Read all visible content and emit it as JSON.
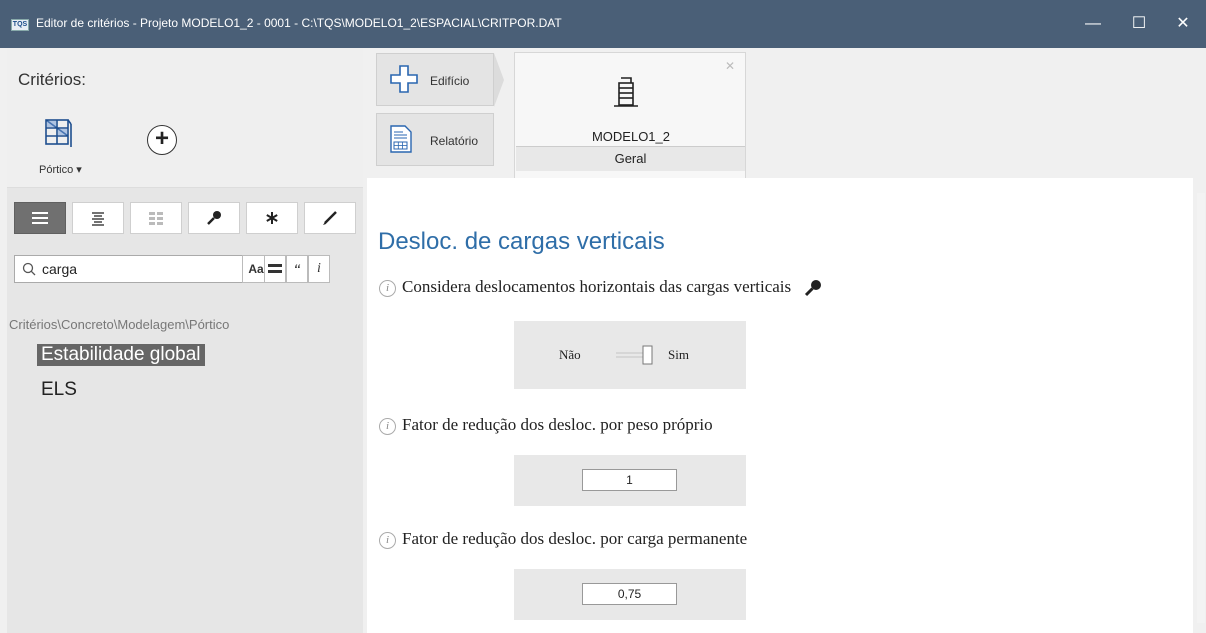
{
  "window": {
    "app_icon_text": "TQS",
    "title": "Editor de critérios - Projeto MODELO1_2 - 0001 - C:\\TQS\\MODELO1_2\\ESPACIAL\\CRITPOR.DAT",
    "min_glyph": "—",
    "max_glyph": "☐",
    "close_glyph": "✕"
  },
  "left": {
    "criterios_label": "Critérios:",
    "portico_label": "Pórtico ▾",
    "add_glyph": "+",
    "search": {
      "value": "carga",
      "aa": "Aa",
      "quote": "‘‘",
      "info": "i"
    },
    "breadcrumb": "Critérios\\Concreto\\Modelagem\\Pórtico",
    "tree": [
      {
        "label": "Estabilidade global",
        "selected": true
      },
      {
        "label": "ELS",
        "selected": false
      }
    ]
  },
  "nav": {
    "edificio": "Edifício",
    "relatorio": "Relatório"
  },
  "card": {
    "close_glyph": "✕",
    "name": "MODELO1_2",
    "tab": "Geral"
  },
  "content": {
    "section_title": "Desloc. de cargas verticais",
    "info_glyph": "i",
    "q1": {
      "label": "Considera deslocamentos horizontais das cargas verticais",
      "no": "Não",
      "yes": "Sim",
      "value": false
    },
    "q2": {
      "label": "Fator de redução dos desloc. por peso próprio",
      "value": "1"
    },
    "q3": {
      "label": "Fator de redução dos desloc. por carga permanente",
      "value": "0,75"
    }
  },
  "colors": {
    "titlebar": "#4a5f77",
    "section_title": "#2f6ea8",
    "selected_tree": "#666666"
  }
}
